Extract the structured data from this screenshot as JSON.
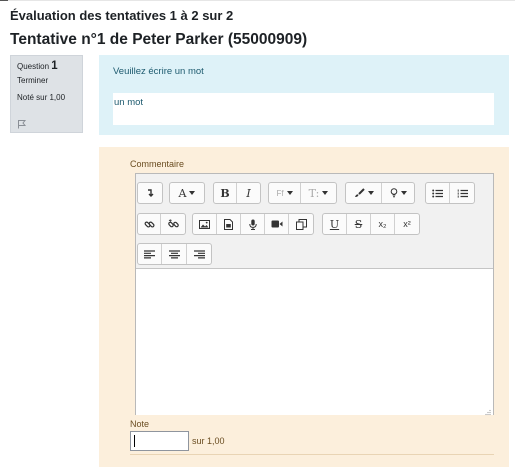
{
  "page": {
    "heading": "Évaluation des tentatives 1 à 2 sur 2",
    "attempt_title": "Tentative n°1 de Peter Parker (55000909)"
  },
  "question_info": {
    "label": "Question",
    "number": "1",
    "state": "Terminer",
    "grade": "Noté sur 1,00",
    "flag_icon": "flag-icon"
  },
  "formulation": {
    "question_text": "Veuillez écrire un mot",
    "answer": "un mot"
  },
  "comment": {
    "label": "Commentaire",
    "editor_content": "",
    "toolbar": {
      "row1": [
        "collapse-icon",
        "font-color-icon",
        "bold-icon",
        "italic-icon",
        "font-family-icon",
        "font-size-icon",
        "paint-brush-icon",
        "lightbulb-icon",
        "unordered-list-icon",
        "ordered-list-icon"
      ],
      "row2": [
        "link-icon",
        "unlink-icon",
        "image-icon",
        "media-icon",
        "record-audio-icon",
        "record-video-icon",
        "manage-files-icon",
        "underline-icon",
        "strikethrough-icon",
        "subscript-icon",
        "superscript-icon"
      ],
      "row3": [
        "align-left-icon",
        "align-center-icon",
        "align-right-icon"
      ],
      "labels": {
        "font_color": "A",
        "bold": "B",
        "italic": "I",
        "font_family": "Ff",
        "font_size": "T:",
        "underline": "U",
        "strikethrough": "S",
        "subscript": "x₂",
        "superscript": "x²"
      }
    }
  },
  "grade": {
    "label": "Note",
    "value": "",
    "max_text": "sur 1,00"
  }
}
